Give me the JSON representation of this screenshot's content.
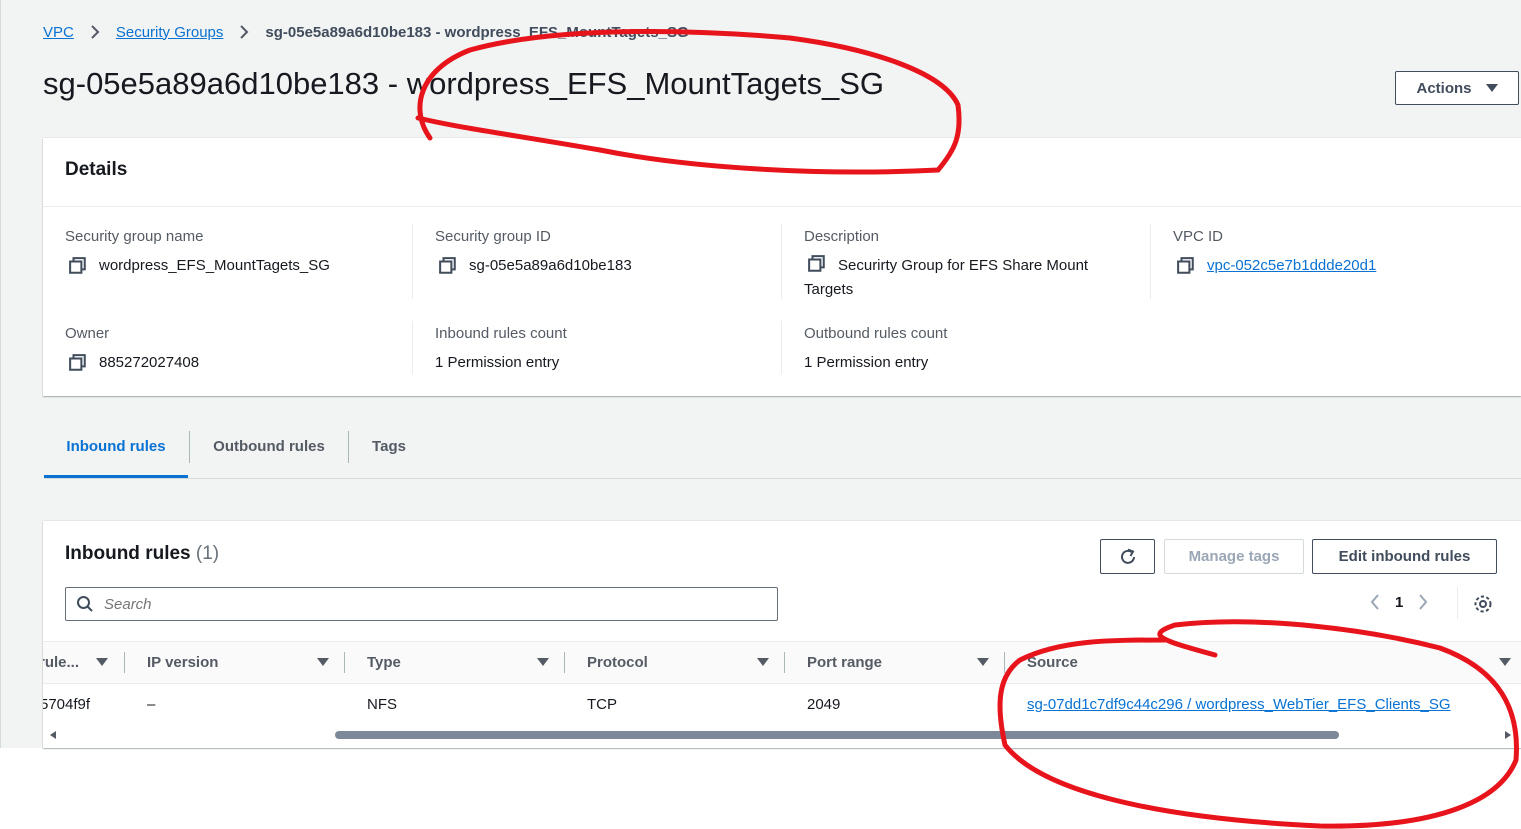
{
  "breadcrumb": {
    "items": [
      "VPC",
      "Security Groups"
    ],
    "current": "sg-05e5a89a6d10be183 - wordpress_EFS_MountTagets_SG"
  },
  "page_title": "sg-05e5a89a6d10be183 - wordpress_EFS_MountTagets_SG",
  "actions_label": "Actions",
  "details": {
    "header": "Details",
    "fields": {
      "sg_name": {
        "label": "Security group name",
        "value": "wordpress_EFS_MountTagets_SG"
      },
      "sg_id": {
        "label": "Security group ID",
        "value": "sg-05e5a89a6d10be183"
      },
      "description": {
        "label": "Description",
        "value": "Securirty Group for EFS Share Mount Targets"
      },
      "vpc_id": {
        "label": "VPC ID",
        "value": "vpc-052c5e7b1ddde20d1"
      },
      "owner": {
        "label": "Owner",
        "value": "885272027408"
      },
      "inbound_count": {
        "label": "Inbound rules count",
        "value": "1 Permission entry"
      },
      "outbound_count": {
        "label": "Outbound rules count",
        "value": "1 Permission entry"
      }
    }
  },
  "tabs": [
    "Inbound rules",
    "Outbound rules",
    "Tags"
  ],
  "active_tab": "Inbound rules",
  "inbound": {
    "title": "Inbound rules",
    "count": "(1)",
    "manage_tags_label": "Manage tags",
    "edit_label": "Edit inbound rules",
    "search_placeholder": "Search",
    "page": "1",
    "columns": [
      "rule...",
      "IP version",
      "Type",
      "Protocol",
      "Port range",
      "Source"
    ],
    "rows": [
      {
        "rule_id": "5704f9f",
        "ip_version": "–",
        "type": "NFS",
        "protocol": "TCP",
        "port_range": "2049",
        "source": "sg-07dd1c7df9c44c296 / wordpress_WebTier_EFS_Clients_SG"
      }
    ]
  },
  "colors": {
    "link": "#0972d3",
    "annotation": "#e8141c",
    "background": "#f2f3f3"
  }
}
